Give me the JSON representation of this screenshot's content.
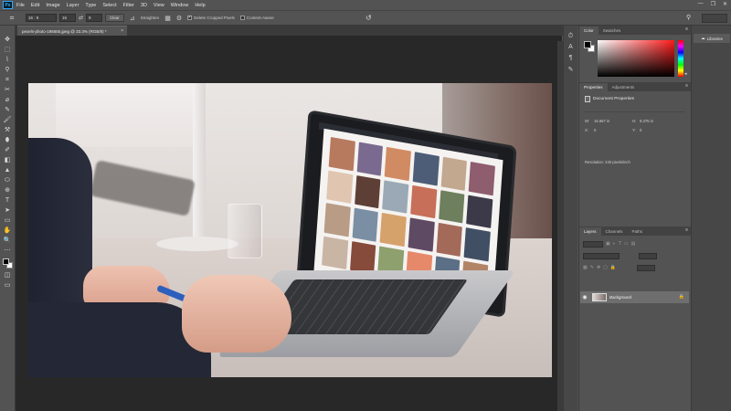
{
  "app": {
    "logo_text": "Ps",
    "menu": [
      "File",
      "Edit",
      "Image",
      "Layer",
      "Type",
      "Select",
      "Filter",
      "3D",
      "View",
      "Window",
      "Help"
    ],
    "window_controls": [
      "—",
      "❐",
      "✕"
    ]
  },
  "options_bar": {
    "ratio_value": "16 : 9",
    "width_value": "16",
    "height_value": "9",
    "clear_label": "Clear",
    "straighten_label": "Straighten",
    "delete_cropped_label": "Delete Cropped Pixels",
    "delete_cropped_checked": true,
    "content_aware_label": "Content-Aware",
    "content_aware_checked": false
  },
  "document": {
    "tab_title": "pexels-photo-196655.jpeg @ 33.3% (RGB/8) *",
    "close": "×"
  },
  "tools": [
    "✥",
    "⬚",
    "⌇",
    "⚲",
    "⌗",
    "✂",
    "⌀",
    "✎",
    "🖌",
    "⚒",
    "⬮",
    "✐",
    "◧",
    "▲",
    "⬭",
    "⊕",
    "T",
    "➤",
    "▭",
    "✋",
    "🔍",
    "⋯"
  ],
  "panels": {
    "color_tabs": [
      "Color",
      "Swatches"
    ],
    "properties_tabs": [
      "Properties",
      "Adjustments"
    ],
    "properties": {
      "header": "Document Properties",
      "w_label": "W:",
      "w_value": "16.667 in",
      "h_label": "H:",
      "h_value": "9.375 in",
      "x_label": "X:",
      "x_value": "0",
      "y_label": "Y:",
      "y_value": "0",
      "resolution": "Resolution: 240 pixels/inch"
    },
    "layers_tabs": [
      "Layers",
      "Channels",
      "Paths"
    ],
    "layers": [
      {
        "name": "Background",
        "visible": true,
        "locked": true
      }
    ]
  },
  "libraries": {
    "label": "Libraries"
  },
  "colors": {
    "accent": "#31a8ff",
    "ui_bg": "#535353",
    "canvas_bg": "#282828"
  }
}
